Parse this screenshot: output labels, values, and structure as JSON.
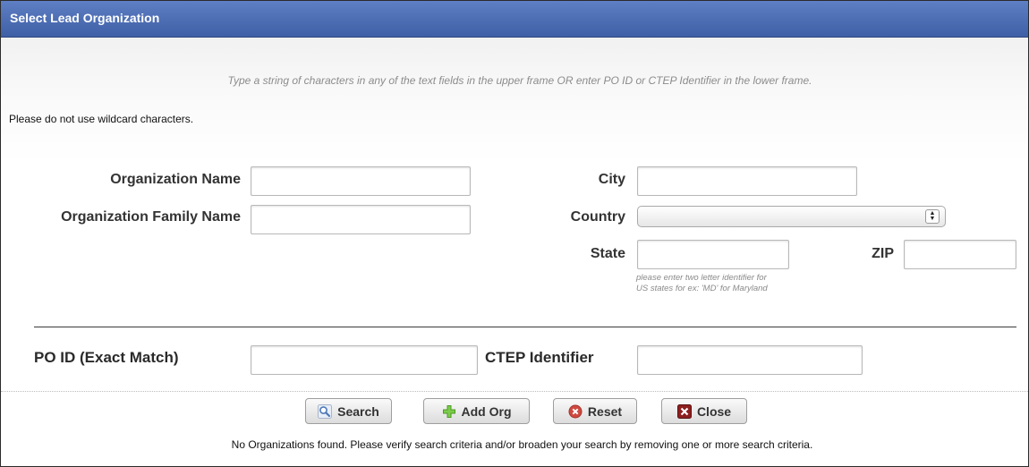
{
  "dialog": {
    "title": "Select Lead Organization",
    "instructions": "Type a string of characters in any of the text fields in the upper frame OR enter PO ID or CTEP Identifier in the lower frame.",
    "wildcard_note": "Please do not use wildcard characters."
  },
  "form": {
    "org_name_label": "Organization Name",
    "org_name_value": "",
    "org_family_label": "Organization Family Name",
    "org_family_value": "",
    "city_label": "City",
    "city_value": "",
    "country_label": "Country",
    "country_selected": "",
    "state_label": "State",
    "state_value": "",
    "state_hint": "please enter two letter identifier for US states for ex: 'MD' for Maryland",
    "zip_label": "ZIP",
    "zip_value": "",
    "po_id_label": "PO ID (Exact Match)",
    "po_id_value": "",
    "ctep_label": "CTEP Identifier",
    "ctep_value": ""
  },
  "buttons": {
    "search": "Search",
    "add_org": "Add Org",
    "reset": "Reset",
    "close": "Close"
  },
  "icons": {
    "search": "magnifier-icon",
    "add_org": "plus-icon",
    "reset": "reset-icon",
    "close": "close-icon"
  },
  "colors": {
    "title_bar": "#4a6ab3",
    "add_icon": "#6cbf3c",
    "reset_icon": "#c9443c",
    "close_icon": "#8a1d1d"
  },
  "status": {
    "no_results": "No Organizations found. Please verify search criteria and/or broaden your search by removing one or more search criteria."
  }
}
